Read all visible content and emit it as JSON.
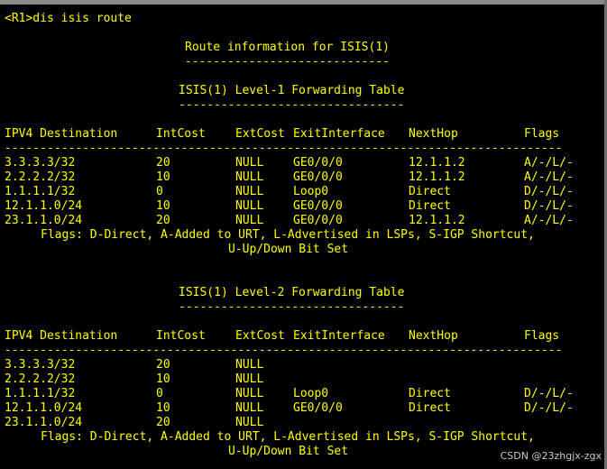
{
  "prompt_command": "<R1>dis isis route",
  "title": "Route information for ISIS(1)",
  "title_underline": "-----------------------------",
  "level1": {
    "heading": "ISIS(1) Level-1 Forwarding Table",
    "heading_underline": "--------------------------------",
    "columns": [
      "IPV4 Destination",
      "IntCost",
      "ExtCost",
      "ExitInterface",
      "NextHop",
      "Flags"
    ],
    "separator": "-------------------------------------------------------------------------------",
    "rows": [
      [
        "3.3.3.3/32",
        "20",
        "NULL",
        "GE0/0/0",
        "12.1.1.2",
        "A/-/L/-"
      ],
      [
        "2.2.2.2/32",
        "10",
        "NULL",
        "GE0/0/0",
        "12.1.1.2",
        "A/-/L/-"
      ],
      [
        "1.1.1.1/32",
        "0",
        "NULL",
        "Loop0",
        "Direct",
        "D/-/L/-"
      ],
      [
        "12.1.1.0/24",
        "10",
        "NULL",
        "GE0/0/0",
        "Direct",
        "D/-/L/-"
      ],
      [
        "23.1.1.0/24",
        "20",
        "NULL",
        "GE0/0/0",
        "12.1.1.2",
        "A/-/L/-"
      ]
    ],
    "flags_line1": "Flags: D-Direct, A-Added to URT, L-Advertised in LSPs, S-IGP Shortcut,",
    "flags_line2": "U-Up/Down Bit Set"
  },
  "level2": {
    "heading": "ISIS(1) Level-2 Forwarding Table",
    "heading_underline": "--------------------------------",
    "columns": [
      "IPV4 Destination",
      "IntCost",
      "ExtCost",
      "ExitInterface",
      "NextHop",
      "Flags"
    ],
    "separator": "-------------------------------------------------------------------------------",
    "rows": [
      [
        "3.3.3.3/32",
        "20",
        "NULL",
        "",
        "",
        ""
      ],
      [
        "2.2.2.2/32",
        "10",
        "NULL",
        "",
        "",
        ""
      ],
      [
        "1.1.1.1/32",
        "0",
        "NULL",
        "Loop0",
        "Direct",
        "D/-/L/-"
      ],
      [
        "12.1.1.0/24",
        "10",
        "NULL",
        "GE0/0/0",
        "Direct",
        "D/-/L/-"
      ],
      [
        "23.1.1.0/24",
        "20",
        "NULL",
        "",
        "",
        ""
      ]
    ],
    "flags_line1": "Flags: D-Direct, A-Added to URT, L-Advertised in LSPs, S-IGP Shortcut,",
    "flags_line2": "U-Up/Down Bit Set"
  },
  "watermark": "CSDN @23zhgjx-zgx"
}
